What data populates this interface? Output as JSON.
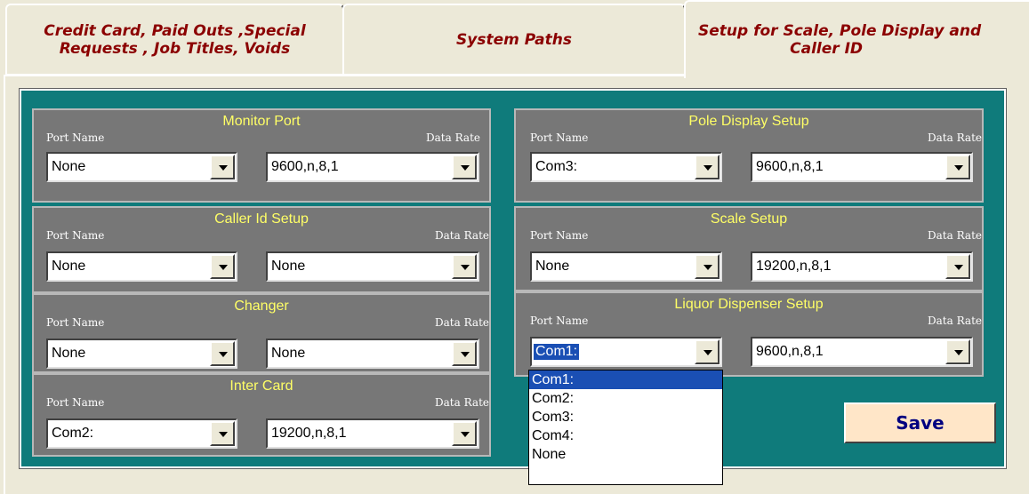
{
  "tabs": [
    {
      "line1": "Credit Card, Paid Outs ,Special",
      "line2": "Requests , Job Titles, Voids"
    },
    {
      "line1": "System Paths",
      "line2": ""
    },
    {
      "line1": "Setup for Scale, Pole Display and",
      "line2": "Caller ID"
    }
  ],
  "labels": {
    "port_name": "Port Name",
    "data_rate": "Data Rate"
  },
  "groups": {
    "monitor": {
      "title": "Monitor Port",
      "port": "None",
      "rate": "9600,n,8,1"
    },
    "caller_id": {
      "title": "Caller Id Setup",
      "port": "None",
      "rate": "None"
    },
    "changer": {
      "title": "Changer",
      "port": "None",
      "rate": "None"
    },
    "inter_card": {
      "title": "Inter Card",
      "port": "Com2:",
      "rate": "19200,n,8,1"
    },
    "pole_display": {
      "title": "Pole Display Setup",
      "port": "Com3:",
      "rate": "9600,n,8,1"
    },
    "scale": {
      "title": "Scale Setup",
      "port": "None",
      "rate": "19200,n,8,1"
    },
    "liquor": {
      "title": "Liquor Dispenser Setup",
      "port": "Com1:",
      "rate": "9600,n,8,1"
    }
  },
  "dropdown": {
    "options": [
      "Com1:",
      "Com2:",
      "Com3:",
      "Com4:",
      "None"
    ],
    "selected": "Com1:"
  },
  "save_label": "Save",
  "colors": {
    "tab_text": "#8b0000",
    "group_title": "#ffff66",
    "frame": "#0f7b7b",
    "save_text": "#000080",
    "save_bg": "#ffe6c8"
  }
}
